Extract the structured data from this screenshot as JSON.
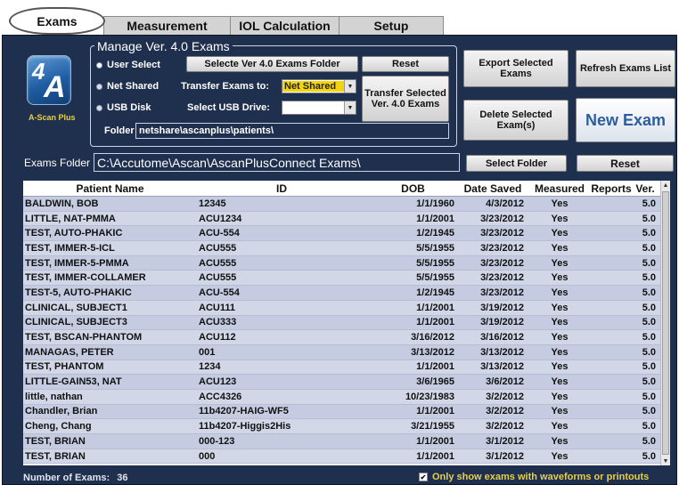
{
  "tabs": [
    {
      "label": "Exams",
      "active": true
    },
    {
      "label": "Measurement"
    },
    {
      "label": "IOL Calculation"
    },
    {
      "label": "Setup"
    }
  ],
  "logo": {
    "mark_top": "4",
    "mark_main": "A",
    "text": "A-Scan Plus"
  },
  "manage": {
    "title": "Manage Ver. 4.0 Exams",
    "radio_user_select": "User Select",
    "radio_net_shared": "Net Shared",
    "radio_usb_disk": "USB Disk",
    "select_folder_button": "Selecte Ver 4.0 Exams Folder",
    "reset_button": "Reset",
    "transfer_label": "Transfer Exams to:",
    "transfer_value": "Net Shared",
    "transfer_button": "Transfer Selected Ver. 4.0 Exams",
    "usb_label": "Select USB Drive:",
    "usb_value": "",
    "folder_label": "Folder",
    "folder_value": "netshare\\ascanplus\\patients\\"
  },
  "actions": {
    "export_button": "Export Selected Exams",
    "refresh_button": "Refresh Exams List",
    "delete_button": "Delete Selected Exam(s)",
    "new_exam_button": "New Exam"
  },
  "exams_folder": {
    "label": "Exams Folder",
    "value": "C:\\Accutome\\Ascan\\AscanPlusConnect Exams\\",
    "select_button": "Select Folder",
    "reset_button": "Reset"
  },
  "table": {
    "columns": [
      "Patient Name",
      "ID",
      "DOB",
      "Date Saved",
      "Measured",
      "Reports",
      "Ver."
    ],
    "rows": [
      [
        "BALDWIN, BOB",
        "12345",
        "1/1/1960",
        "4/3/2012",
        "Yes",
        "",
        "5.0"
      ],
      [
        "LITTLE, NAT-PMMA",
        "ACU1234",
        "1/1/2001",
        "3/23/2012",
        "Yes",
        "",
        "5.0"
      ],
      [
        "TEST, AUTO-PHAKIC",
        "ACU-554",
        "1/2/1945",
        "3/23/2012",
        "Yes",
        "",
        "5.0"
      ],
      [
        "TEST, IMMER-5-ICL",
        "ACU555",
        "5/5/1955",
        "3/23/2012",
        "Yes",
        "",
        "5.0"
      ],
      [
        "TEST, IMMER-5-PMMA",
        "ACU555",
        "5/5/1955",
        "3/23/2012",
        "Yes",
        "",
        "5.0"
      ],
      [
        "TEST, IMMER-COLLAMER",
        "ACU555",
        "5/5/1955",
        "3/23/2012",
        "Yes",
        "",
        "5.0"
      ],
      [
        "TEST-5, AUTO-PHAKIC",
        "ACU-554",
        "1/2/1945",
        "3/23/2012",
        "Yes",
        "",
        "5.0"
      ],
      [
        "CLINICAL, SUBJECT1",
        "ACU111",
        "1/1/2001",
        "3/19/2012",
        "Yes",
        "",
        "5.0"
      ],
      [
        "CLINICAL, SUBJECT3",
        "ACU333",
        "1/1/2001",
        "3/19/2012",
        "Yes",
        "",
        "5.0"
      ],
      [
        "TEST, BSCAN-PHANTOM",
        "ACU112",
        "3/16/2012",
        "3/16/2012",
        "Yes",
        "",
        "5.0"
      ],
      [
        "MANAGAS, PETER",
        "001",
        "3/13/2012",
        "3/13/2012",
        "Yes",
        "",
        "5.0"
      ],
      [
        "TEST, PHANTOM",
        "1234",
        "1/1/2001",
        "3/13/2012",
        "Yes",
        "",
        "5.0"
      ],
      [
        "LITTLE-GAIN53, NAT",
        "ACU123",
        "3/6/1965",
        "3/6/2012",
        "Yes",
        "",
        "5.0"
      ],
      [
        "little, nathan",
        "ACC4326",
        "10/23/1983",
        "3/2/2012",
        "Yes",
        "",
        "5.0"
      ],
      [
        "Chandler, Brian",
        "11b4207-HAIG-WF5",
        "1/1/2001",
        "3/2/2012",
        "Yes",
        "",
        "5.0"
      ],
      [
        "Cheng, Chang",
        "11b4207-Higgis2His",
        "3/21/1955",
        "3/2/2012",
        "Yes",
        "",
        "5.0"
      ],
      [
        "TEST, BRIAN",
        "000-123",
        "1/1/2001",
        "3/1/2012",
        "Yes",
        "",
        "5.0"
      ],
      [
        "TEST, BRIAN",
        "000",
        "1/1/2001",
        "3/1/2012",
        "Yes",
        "",
        "5.0"
      ]
    ]
  },
  "footer": {
    "count_label": "Number of Exams:",
    "count_value": "36",
    "waveform_filter_checked": true,
    "waveform_filter_label": "Only show exams with waveforms or printouts"
  },
  "colors": {
    "panel": "#1f2f4e",
    "row_odd": "#c5cce1",
    "row_even": "#d1d7e7",
    "accent_yellow": "#e6cf4a",
    "new_exam_text": "#2c5e9e"
  },
  "icons": {
    "logo": "a-scan-plus-logo",
    "dropdown": "chevron-down-icon",
    "scroll_up": "arrow-up-icon",
    "scroll_down": "arrow-down-icon",
    "checkbox": "checkbox-checked-icon"
  }
}
